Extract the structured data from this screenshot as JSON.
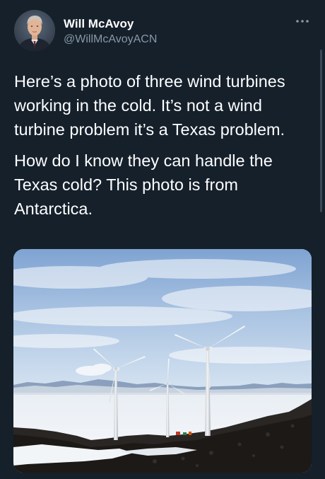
{
  "tweet": {
    "author": {
      "display_name": "Will McAvoy",
      "handle": "@WillMcAvoyACN"
    },
    "more_icon": "more-horizontal-icon",
    "paragraphs": [
      "Here’s a photo of three wind turbines working in the cold. It’s not a wind turbine problem it’s a Texas problem.",
      "How do I know they can handle the Texas cold? This photo is from Antarctica."
    ],
    "media": {
      "type": "photo"
    }
  },
  "colors": {
    "background": "#15202b",
    "text_primary": "#ffffff",
    "text_secondary": "#8899a6"
  }
}
